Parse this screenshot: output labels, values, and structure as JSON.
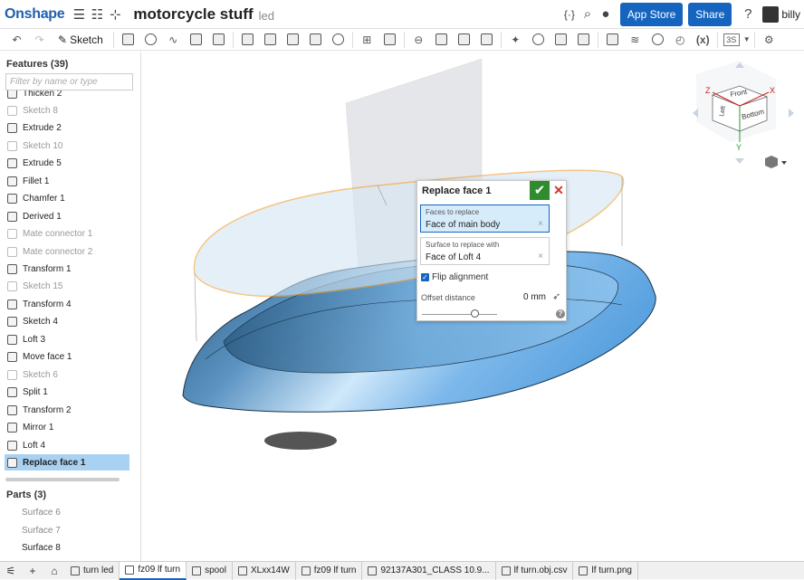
{
  "app": {
    "logo": "Onshape",
    "document_title": "motorcycle stuff",
    "workspace": "led",
    "app_store_label": "App Store",
    "share_label": "Share",
    "user_name": "billy"
  },
  "toolbar": {
    "sketch_label": "Sketch",
    "view_label": "3S",
    "variable_label": "(x)"
  },
  "features": {
    "header": "Features (39)",
    "filter_placeholder": "Filter by name or type",
    "items": [
      {
        "label": "Thicken 2",
        "dim": false
      },
      {
        "label": "Sketch 8",
        "dim": true
      },
      {
        "label": "Extrude 2",
        "dim": false
      },
      {
        "label": "Sketch 10",
        "dim": true
      },
      {
        "label": "Extrude 5",
        "dim": false
      },
      {
        "label": "Fillet 1",
        "dim": false
      },
      {
        "label": "Chamfer 1",
        "dim": false
      },
      {
        "label": "Derived 1",
        "dim": false
      },
      {
        "label": "Mate connector 1",
        "dim": true
      },
      {
        "label": "Mate connector 2",
        "dim": true
      },
      {
        "label": "Transform 1",
        "dim": false
      },
      {
        "label": "Sketch 15",
        "dim": true
      },
      {
        "label": "Transform 4",
        "dim": false
      },
      {
        "label": "Sketch 4",
        "dim": false
      },
      {
        "label": "Loft 3",
        "dim": false
      },
      {
        "label": "Move face 1",
        "dim": false
      },
      {
        "label": "Sketch 6",
        "dim": true
      },
      {
        "label": "Split 1",
        "dim": false
      },
      {
        "label": "Transform 2",
        "dim": false
      },
      {
        "label": "Mirror 1",
        "dim": false
      },
      {
        "label": "Loft 4",
        "dim": false
      },
      {
        "label": "Replace face 1",
        "dim": false,
        "selected": true
      }
    ]
  },
  "parts": {
    "header": "Parts (3)",
    "items": [
      "Surface 6",
      "Surface 7",
      "Surface 8"
    ]
  },
  "dialog": {
    "title": "Replace face 1",
    "faces_label": "Faces to replace",
    "faces_value": "Face of main body",
    "surface_label": "Surface to replace with",
    "surface_value": "Face of Loft 4",
    "flip_label": "Flip alignment",
    "flip_checked": true,
    "offset_label": "Offset distance",
    "offset_value": "0 mm"
  },
  "viewcube": {
    "front": "Front",
    "bottom": "Bottom",
    "left": "Left",
    "axis_x": "X",
    "axis_y": "Y",
    "axis_z": "Z"
  },
  "tabs": [
    {
      "label": "turn led",
      "active": false
    },
    {
      "label": "fz09 lf turn",
      "active": true
    },
    {
      "label": "spool",
      "active": false
    },
    {
      "label": "XLxx14W",
      "active": false
    },
    {
      "label": "fz09 lf turn",
      "active": false
    },
    {
      "label": "92137A301_CLASS 10.9...",
      "active": false
    },
    {
      "label": "lf turn.obj.csv",
      "active": false
    },
    {
      "label": "lf turn.png",
      "active": false
    }
  ],
  "colors": {
    "brand": "#1f5fae",
    "accent": "#1565c0",
    "selection": "#a9d2f2",
    "ok": "#2e8b2e",
    "cancel": "#d0342c",
    "edge_highlight": "#f0a030"
  }
}
